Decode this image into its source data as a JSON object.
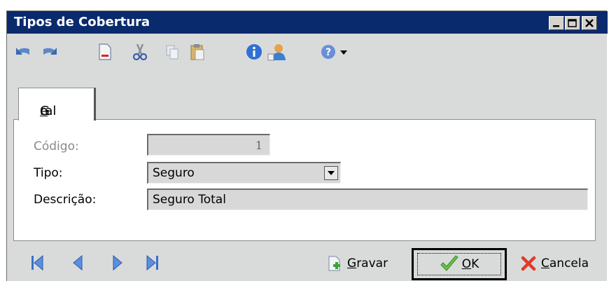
{
  "window": {
    "title": "Tipos de Cobertura",
    "title_bg": "#0a2a6e"
  },
  "toolbar": {
    "icons": [
      "undo-icon",
      "redo-icon",
      "new-document-icon",
      "cut-icon",
      "copy-icon",
      "paste-icon",
      "info-icon",
      "user-icon",
      "help-icon",
      "dropdown-arrow-icon"
    ]
  },
  "tabs": [
    {
      "label_pre": "G",
      "label_accel": "e",
      "label_post": "ral"
    }
  ],
  "form": {
    "codigo_label": "Código:",
    "codigo_value": "1",
    "tipo_label": "Tipo:",
    "tipo_value": "Seguro",
    "descricao_label": "Descrição:",
    "descricao_value": "Seguro Total"
  },
  "nav": {
    "icons": [
      "first-record-icon",
      "previous-record-icon",
      "next-record-icon",
      "last-record-icon"
    ]
  },
  "actions": {
    "gravar_accel": "G",
    "gravar_rest": "ravar",
    "ok_accel": "O",
    "ok_rest": "K",
    "cancela_accel": "C",
    "cancela_rest": "ancela"
  }
}
